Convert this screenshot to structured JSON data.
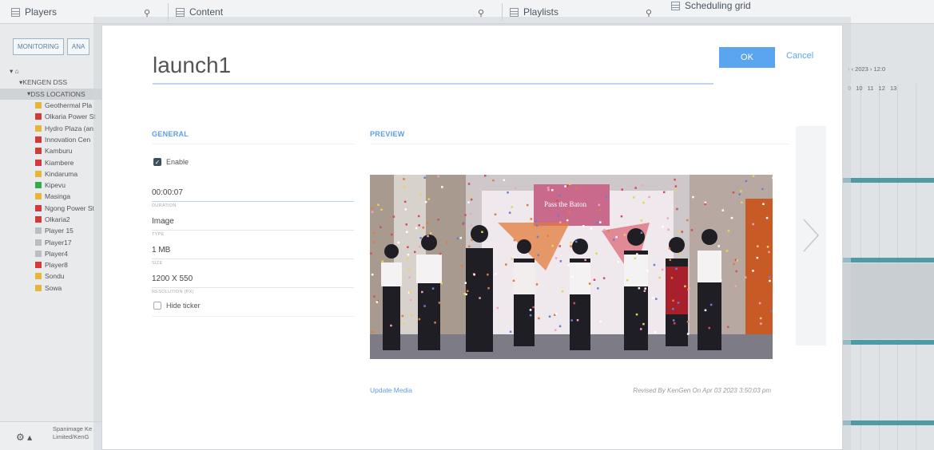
{
  "app": {
    "panes": [
      {
        "title": "Players"
      },
      {
        "title": "Content"
      },
      {
        "title": "Playlists"
      },
      {
        "title": "Scheduling grid"
      }
    ],
    "left_tabs": [
      "MONITORING",
      "ANA"
    ],
    "tree": [
      {
        "label": "",
        "color": "",
        "indent": 0,
        "kind": "home"
      },
      {
        "label": "KENGEN DSS",
        "color": "",
        "indent": 1,
        "kind": "node"
      },
      {
        "label": "DSS LOCATIONS",
        "color": "",
        "indent": 2,
        "kind": "node-sel"
      },
      {
        "label": "Geothermal Pla",
        "color": "#e7b43c",
        "indent": 3
      },
      {
        "label": "Olkaria Power St",
        "color": "#d23a3a",
        "indent": 3
      },
      {
        "label": "Hydro Plaza (an",
        "color": "#e7b43c",
        "indent": 3
      },
      {
        "label": "Innovation Cen",
        "color": "#d23a3a",
        "indent": 3
      },
      {
        "label": "Kamburu",
        "color": "#d23a3a",
        "indent": 3
      },
      {
        "label": "Kiambere",
        "color": "#d23a3a",
        "indent": 3
      },
      {
        "label": "Kindaruma",
        "color": "#e7b43c",
        "indent": 3
      },
      {
        "label": "Kipevu",
        "color": "#3aa74a",
        "indent": 3
      },
      {
        "label": "Masinga",
        "color": "#e7b43c",
        "indent": 3
      },
      {
        "label": "Ngong Power St",
        "color": "#d23a3a",
        "indent": 3
      },
      {
        "label": "Olkaria2",
        "color": "#d23a3a",
        "indent": 3
      },
      {
        "label": "Player 15",
        "color": "#b9bec3",
        "indent": 3
      },
      {
        "label": "Player17",
        "color": "#b9bec3",
        "indent": 3
      },
      {
        "label": "Player4",
        "color": "#b9bec3",
        "indent": 3
      },
      {
        "label": "Player8",
        "color": "#d23a3a",
        "indent": 3
      },
      {
        "label": "Sondu",
        "color": "#e7b43c",
        "indent": 3
      },
      {
        "label": "Sowa",
        "color": "#e7b43c",
        "indent": 3
      }
    ],
    "footer_text": "Spanimage Ke Limited/KenG",
    "calendar_nav": "›  ‹  2023  ›  12:0",
    "calendar_dates": "9  10  11  12  13"
  },
  "modal": {
    "title": "launch1",
    "ok_label": "OK",
    "cancel_label": "Cancel",
    "general_label": "GENERAL",
    "preview_label": "PREVIEW",
    "enable_label": "Enable",
    "enable_checked": true,
    "fields": [
      {
        "value": "00:00:07",
        "label": "DURATION"
      },
      {
        "value": "Image",
        "label": "TYPE"
      },
      {
        "value": "1 MB",
        "label": "SIZE"
      },
      {
        "value": "1200 X 550",
        "label": "RESOLUTION (PX)"
      }
    ],
    "hide_ticker_label": "Hide ticker",
    "hide_ticker_checked": false,
    "banner_text_1": "Pass the Baton",
    "update_media_label": "Update Media",
    "revised_text": "Revised By KenGen On Apr 03 2023 3:50:03 pm"
  },
  "colors": {
    "accent": "#5ba4f0",
    "online": "#3aa74a",
    "warning": "#e7b43c",
    "offline": "#d23a3a"
  }
}
